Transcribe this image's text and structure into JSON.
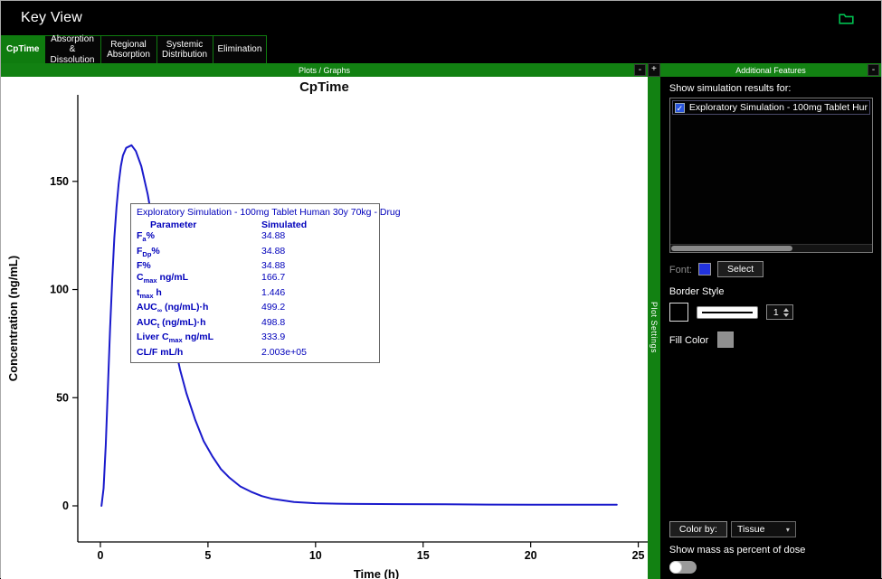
{
  "window": {
    "title": "Key View"
  },
  "tabs": [
    {
      "label": "CpTime",
      "active": true
    },
    {
      "label": "Absorption & Dissolution",
      "active": false
    },
    {
      "label": "Regional Absorption",
      "active": false
    },
    {
      "label": "Systemic Distribution",
      "active": false
    },
    {
      "label": "Elimination",
      "active": false
    }
  ],
  "plot_panel": {
    "header": "Plots / Graphs",
    "minimize_label": "-",
    "expand_label": "+",
    "settings_strip_label": "Plot Settings"
  },
  "chart_data": {
    "type": "line",
    "title": "CpTime",
    "xlabel": "Time (h)",
    "ylabel": "Concentration (ng/mL)",
    "xlim": [
      -1.05,
      26.7
    ],
    "ylim": [
      -16.7,
      190
    ],
    "xticks": [
      0,
      5,
      10,
      15,
      20,
      25
    ],
    "yticks": [
      0,
      50,
      100,
      150
    ],
    "grid": false,
    "legend": "none",
    "line_color": "#1a1acc",
    "series": [
      {
        "name": "Exploratory Simulation - 100mg Tablet Human 30y 70kg - Drug",
        "x": [
          0.05,
          0.15,
          0.25,
          0.35,
          0.45,
          0.55,
          0.65,
          0.75,
          0.85,
          0.95,
          1.05,
          1.2,
          1.446,
          1.65,
          1.9,
          2.2,
          2.5,
          2.8,
          3.1,
          3.4,
          3.7,
          4.0,
          4.4,
          4.8,
          5.2,
          5.6,
          6.0,
          6.5,
          7.0,
          7.5,
          8.0,
          9.0,
          10,
          11,
          12,
          14,
          16,
          18,
          20,
          22,
          24
        ],
        "y": [
          0,
          8,
          28,
          55,
          82,
          105,
          124,
          138,
          149,
          157,
          162,
          165.5,
          166.7,
          164,
          157,
          144,
          127,
          109,
          92,
          77,
          63,
          52,
          40,
          30,
          23,
          17,
          13,
          9,
          6.5,
          4.5,
          3.2,
          1.8,
          1.2,
          1.0,
          0.9,
          0.8,
          0.7,
          0.6,
          0.55,
          0.5,
          0.5
        ]
      }
    ]
  },
  "tooltip": {
    "title": "Exploratory Simulation - 100mg Tablet Human 30y 70kg - Drug",
    "col_parameter": "Parameter",
    "col_simulated": "Simulated",
    "rows": [
      {
        "pre": "F",
        "sub": "a",
        "post": "%",
        "value": "34.88"
      },
      {
        "pre": "F",
        "sub": "Dp",
        "post": "%",
        "value": "34.88"
      },
      {
        "pre": "F%",
        "sub": "",
        "post": "",
        "value": "34.88"
      },
      {
        "pre": "C",
        "sub": "max",
        "post": " ng/mL",
        "value": "166.7"
      },
      {
        "pre": "t",
        "sub": "max",
        "post": " h",
        "value": "1.446"
      },
      {
        "pre": "AUC",
        "sub": "∞",
        "post": " (ng/mL)·h",
        "value": "499.2"
      },
      {
        "pre": "AUC",
        "sub": "t",
        "post": " (ng/mL)·h",
        "value": "498.8"
      },
      {
        "pre": "Liver C",
        "sub": "max",
        "post": " ng/mL",
        "value": "333.9"
      },
      {
        "pre": "CL/F mL/h",
        "sub": "",
        "post": "",
        "value": "2.003e+05"
      }
    ]
  },
  "sidebar": {
    "header": "Additional Features",
    "minimize_label": "-",
    "show_results_label": "Show simulation results for:",
    "simulations": [
      {
        "label": "Exploratory Simulation - 100mg Tablet Hur",
        "checked": true
      }
    ],
    "font_label": "Font:",
    "select_button_label": "Select",
    "border_style_label": "Border Style",
    "border_width_value": "1",
    "fill_color_label": "Fill Color",
    "color_by_label": "Color by:",
    "color_by_value": "Tissue",
    "mass_label": "Show mass as percent of dose"
  },
  "colors": {
    "accent_green": "#128112",
    "tab_green": "#0f7c0f",
    "curve_blue": "#1a1acc",
    "tooltip_text": "#0000bb",
    "checkbox_blue": "#2a55dd",
    "font_swatch_blue": "#2233dd",
    "fill_swatch_gray": "#8f8f8f",
    "title_icon_green": "#00c050"
  }
}
